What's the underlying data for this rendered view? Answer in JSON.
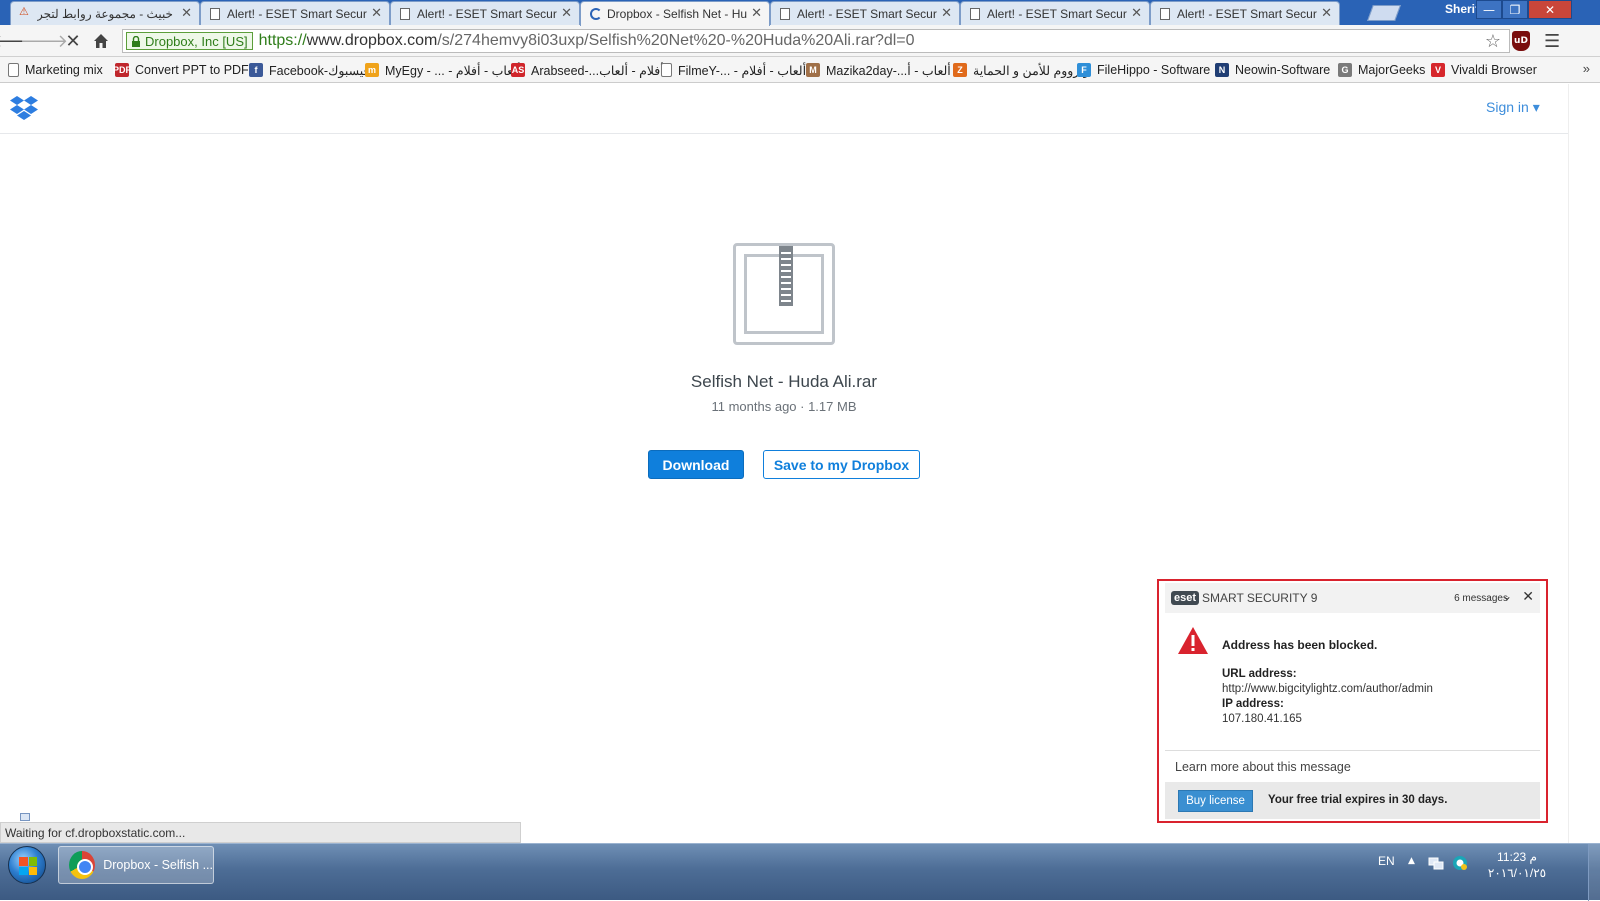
{
  "tabs": [
    {
      "title": "رابط خبيث - مجموعة روابط لتجر",
      "icon": "arabic-site-icon",
      "active": false
    },
    {
      "title": "Alert! - ESET Smart Securit",
      "icon": "page-icon",
      "active": false
    },
    {
      "title": "Alert! - ESET Smart Securit",
      "icon": "page-icon",
      "active": false
    },
    {
      "title": "Dropbox - Selfish Net - Hu",
      "icon": "loading-spinner-icon",
      "active": true
    },
    {
      "title": "Alert! - ESET Smart Securit",
      "icon": "page-icon",
      "active": false
    },
    {
      "title": "Alert! - ESET Smart Securit",
      "icon": "page-icon",
      "active": false
    },
    {
      "title": "Alert! - ESET Smart Securit",
      "icon": "page-icon",
      "active": false
    }
  ],
  "window": {
    "profile_name": "Sherif",
    "minimize": "—",
    "maximize": "❐",
    "close": "✕"
  },
  "toolbar": {
    "ev_label": "Dropbox, Inc [US]",
    "url_scheme": "https://",
    "url_host": "www.dropbox.com",
    "url_rest": "/s/274hemvy8i03uxp/Selfish%20Net%20-%20Huda%20Ali.rar?dl=0",
    "extension_label": "uD"
  },
  "bookmarks": [
    {
      "label": "Marketing mix",
      "icon": "page-icon",
      "color": "#ffffff"
    },
    {
      "label": "Convert PPT to PDF",
      "icon": "pdf-icon",
      "color": "#c0272d",
      "glyph": "PDF"
    },
    {
      "label": "Facebook-فيسبوك",
      "icon": "facebook-icon",
      "color": "#3b5998",
      "glyph": "f"
    },
    {
      "label": "MyEgy - ... - ألعاب - أفلام",
      "icon": "myegy-icon",
      "color": "#f0a31a",
      "glyph": "m"
    },
    {
      "label": "Arabseed-...أفلام - ألعاب",
      "icon": "arabseed-icon",
      "color": "#d0262b",
      "glyph": "AS"
    },
    {
      "label": "FilmeY-... - ألعاب - أفلام",
      "icon": "page-icon",
      "color": "#ffffff"
    },
    {
      "label": "Mazika2day-...ألعاب - أ",
      "icon": "mazika-icon",
      "color": "#a07048",
      "glyph": "M"
    },
    {
      "label": "زيزووم للأمن و الحماية",
      "icon": "zizoom-icon",
      "color": "#e06a1b",
      "glyph": "Z"
    },
    {
      "label": "FileHippo - Software",
      "icon": "filehippo-icon",
      "color": "#2f8fd8",
      "glyph": "F"
    },
    {
      "label": "Neowin-Software",
      "icon": "neowin-icon",
      "color": "#1f3d73",
      "glyph": "N"
    },
    {
      "label": "MajorGeeks",
      "icon": "majorgeeks-icon",
      "color": "#7a7a7a",
      "glyph": "G"
    },
    {
      "label": "Vivaldi Browser",
      "icon": "vivaldi-icon",
      "color": "#d6262b",
      "glyph": "V"
    }
  ],
  "dropbox": {
    "sign_in": "Sign in ▾",
    "file_name": "Selfish Net - Huda Ali.rar",
    "file_meta": "11 months ago · 1.17 MB",
    "download_label": "Download",
    "save_label": "Save to my Dropbox",
    "accent": "#0f7fdc"
  },
  "eset": {
    "logo": "eset",
    "product": "SMART SECURITY 9",
    "messages_count": "6 messages",
    "title": "Address has been blocked.",
    "url_label": "URL address:",
    "url_value": "http://www.bigcitylightz.com/author/admin",
    "ip_label": "IP address:",
    "ip_value": "107.180.41.165",
    "learn_more": "Learn more about this message",
    "buy_label": "Buy license",
    "trial_text": "Your free trial expires in 30 days.",
    "border_color": "#d9232e"
  },
  "status": {
    "text": "Waiting for cf.dropboxstatic.com..."
  },
  "taskbar": {
    "task_label": "Dropbox - Selfish ...",
    "lang": "EN",
    "time": "11:23 م",
    "date": "٢٠١٦/٠١/٢٥"
  }
}
